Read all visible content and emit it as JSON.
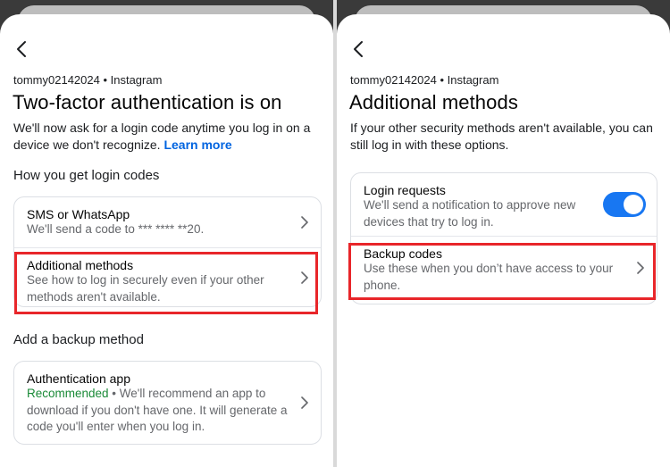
{
  "left": {
    "account": "tommy02142024 • Instagram",
    "title": "Two-factor authentication is on",
    "description": "We'll now ask for a login code anytime you log in on a device we don't recognize.",
    "learn_more": "Learn more",
    "section_codes": "How you get login codes",
    "sms": {
      "title": "SMS or WhatsApp",
      "subtitle": "We'll send a code to *** **** **20."
    },
    "additional": {
      "title": "Additional methods",
      "subtitle": "See how to log in securely even if your other methods aren't available."
    },
    "section_backup": "Add a backup method",
    "auth_app": {
      "title": "Authentication app",
      "recommended": "Recommended",
      "subtitle": " • We'll recommend an app to download if you don't have one. It will generate a code you'll enter when you log in."
    }
  },
  "right": {
    "account": "tommy02142024 • Instagram",
    "title": "Additional methods",
    "description": "If your other security methods aren't available, you can still log in with these options.",
    "login_requests": {
      "title": "Login requests",
      "subtitle": "We'll send a notification to approve new devices that try to log in.",
      "enabled": true
    },
    "backup_codes": {
      "title": "Backup codes",
      "subtitle": "Use these when you don’t have access to your phone."
    }
  },
  "colors": {
    "accent": "#1877f2",
    "link": "#0064e0",
    "highlight": "#e8262a",
    "recommended": "#1a8a37"
  },
  "icons": {
    "back": "chevron-left-icon",
    "row": "chevron-right-icon"
  }
}
